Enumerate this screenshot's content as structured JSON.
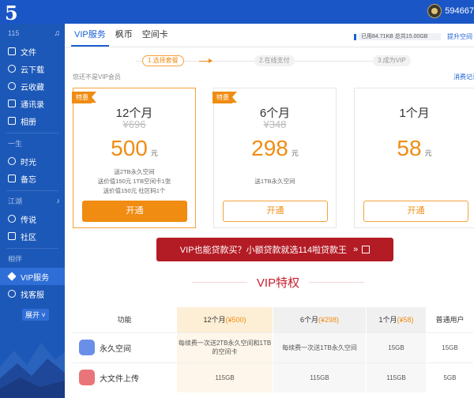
{
  "header": {
    "logo": "5",
    "user_id": "594667"
  },
  "sidebar": {
    "sections": [
      {
        "label": "115",
        "items": [
          {
            "label": "文件",
            "icon": "folder-icon"
          },
          {
            "label": "云下载",
            "icon": "cloud-download-icon"
          },
          {
            "label": "云收藏",
            "icon": "cloud-star-icon"
          },
          {
            "label": "通讯录",
            "icon": "contacts-icon"
          },
          {
            "label": "相册",
            "icon": "photo-icon"
          }
        ]
      },
      {
        "label": "一生",
        "items": [
          {
            "label": "时光",
            "icon": "clock-icon"
          },
          {
            "label": "备忘",
            "icon": "memo-icon"
          }
        ]
      },
      {
        "label": "江湖",
        "items": [
          {
            "label": "传说",
            "icon": "legend-icon"
          },
          {
            "label": "社区",
            "icon": "community-icon"
          }
        ]
      },
      {
        "label": "相伴",
        "items": [
          {
            "label": "VIP服务",
            "icon": "vip-diamond-icon",
            "active": true
          },
          {
            "label": "找客服",
            "icon": "service-icon"
          }
        ]
      }
    ],
    "expand_label": "展开"
  },
  "tabs": [
    {
      "label": "VIP服务",
      "active": true
    },
    {
      "label": "枫币"
    },
    {
      "label": "空间卡"
    }
  ],
  "storage": {
    "text": "已用84.71KB 总共15.00GB",
    "upgrade_label": "提升空间"
  },
  "steps": [
    "1.选择套餐",
    "2.在线支付",
    "3.成为VIP"
  ],
  "not_vip_text": "您还不是VIP会员",
  "record_link": "消费记录",
  "plans": [
    {
      "badge": "特惠",
      "name": "12个月",
      "original": "¥696",
      "price": "500",
      "unit": "元",
      "desc": [
        "送2TB永久空间",
        "送价值150元 1TB空间卡1张",
        "送价值150元 社区码1个"
      ],
      "button": "开通",
      "selected": true
    },
    {
      "badge": "特惠",
      "name": "6个月",
      "original": "¥348",
      "price": "298",
      "unit": "元",
      "desc": [
        "送1TB永久空间"
      ],
      "button": "开通"
    },
    {
      "name": "1个月",
      "price": "58",
      "unit": "元",
      "button": "开通"
    }
  ],
  "banner": "VIP也能贷款买？小额贷款就选114啦贷款王",
  "vip_title": "VIP特权",
  "table": {
    "headers": [
      "功能",
      "12个月",
      "(¥500)",
      "6个月",
      "(¥298)",
      "1个月",
      "(¥58)",
      "普通用户"
    ],
    "rows": [
      {
        "feature": "永久空间",
        "icon": "cloud-storage-icon",
        "cells": [
          "每续费一次送2TB永久空间和1TB的空间卡",
          "每续费一次送1TB永久空间",
          "15GB",
          "15GB"
        ]
      },
      {
        "feature": "大文件上传",
        "icon": "upload-icon",
        "cells": [
          "115GB",
          "115GB",
          "115GB",
          "5GB"
        ]
      }
    ]
  },
  "colors": {
    "header_blue": "#1a56c6",
    "sidebar_blue": "#1c58b7",
    "accent_orange": "#f08c12",
    "banner_red": "#b31b25",
    "title_red": "#c7202e"
  }
}
